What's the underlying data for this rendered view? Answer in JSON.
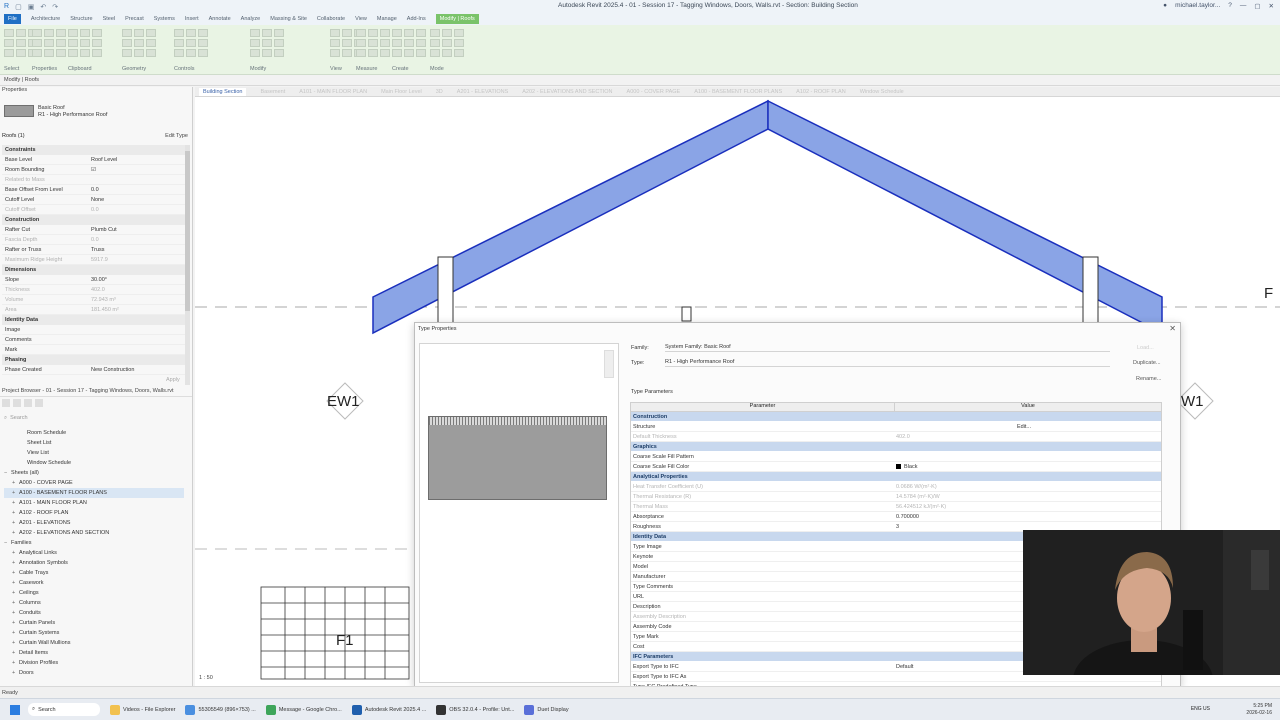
{
  "window": {
    "title": "Autodesk Revit 2025.4 - 01 - Session 17 - Tagging Windows, Doors, Walls.rvt - Section: Building Section",
    "user": "michael.taylor..."
  },
  "ribbon": {
    "tabs": [
      "File",
      "Architecture",
      "Structure",
      "Steel",
      "Precast",
      "Systems",
      "Insert",
      "Annotate",
      "Analyze",
      "Massing & Site",
      "Collaborate",
      "View",
      "Manage",
      "Add-Ins",
      "Modify | Roofs"
    ],
    "groups": [
      "Select",
      "Properties",
      "Clipboard",
      "Geometry",
      "Controls",
      "Modify",
      "View",
      "Measure",
      "Create",
      "Mode"
    ],
    "context_label": "Modify | Roofs"
  },
  "properties": {
    "header": "Properties",
    "type_family": "Basic Roof",
    "type_name": "R1 - High Performance Roof",
    "count": "Roofs (1)",
    "edit_type": "Edit Type",
    "sections": [
      {
        "name": "Constraints",
        "rows": [
          {
            "k": "Base Level",
            "v": "Roof Level",
            "dim": false
          },
          {
            "k": "Room Bounding",
            "v": "☑",
            "dim": false
          },
          {
            "k": "Related to Mass",
            "v": "",
            "dim": true
          },
          {
            "k": "Base Offset From Level",
            "v": "0.0",
            "dim": false
          },
          {
            "k": "Cutoff Level",
            "v": "None",
            "dim": false
          },
          {
            "k": "Cutoff Offset",
            "v": "0.0",
            "dim": true
          }
        ]
      },
      {
        "name": "Construction",
        "rows": [
          {
            "k": "Rafter Cut",
            "v": "Plumb Cut",
            "dim": false
          },
          {
            "k": "Fascia Depth",
            "v": "0.0",
            "dim": true
          },
          {
            "k": "Rafter or Truss",
            "v": "Truss",
            "dim": false
          },
          {
            "k": "Maximum Ridge Height",
            "v": "5917.9",
            "dim": true
          }
        ]
      },
      {
        "name": "Dimensions",
        "rows": [
          {
            "k": "Slope",
            "v": "30.00°",
            "dim": false
          },
          {
            "k": "Thickness",
            "v": "402.0",
            "dim": true
          },
          {
            "k": "Volume",
            "v": "72.943 m³",
            "dim": true
          },
          {
            "k": "Area",
            "v": "181.450 m²",
            "dim": true
          }
        ]
      },
      {
        "name": "Identity Data",
        "rows": [
          {
            "k": "Image",
            "v": "",
            "dim": false
          },
          {
            "k": "Comments",
            "v": "",
            "dim": false
          },
          {
            "k": "Mark",
            "v": "",
            "dim": false
          }
        ]
      },
      {
        "name": "Phasing",
        "rows": [
          {
            "k": "Phase Created",
            "v": "New Construction",
            "dim": false
          }
        ]
      }
    ],
    "apply": "Apply"
  },
  "browser": {
    "header": "Project Browser - 01 - Session 17 - Tagging Windows, Doors, Walls.rvt",
    "search_placeholder": "Search",
    "items": [
      {
        "label": "Room Schedule",
        "indent": 2,
        "pm": "",
        "sel": false
      },
      {
        "label": "Sheet List",
        "indent": 2,
        "pm": "",
        "sel": false
      },
      {
        "label": "View List",
        "indent": 2,
        "pm": "",
        "sel": false
      },
      {
        "label": "Window Schedule",
        "indent": 2,
        "pm": "",
        "sel": false
      },
      {
        "label": "Sheets (all)",
        "indent": 0,
        "pm": "−",
        "sel": false
      },
      {
        "label": "A000 - COVER PAGE",
        "indent": 1,
        "pm": "+",
        "sel": false
      },
      {
        "label": "A100 - BASEMENT FLOOR PLANS",
        "indent": 1,
        "pm": "+",
        "sel": true
      },
      {
        "label": "A101 - MAIN FLOOR PLAN",
        "indent": 1,
        "pm": "+",
        "sel": false
      },
      {
        "label": "A102 - ROOF PLAN",
        "indent": 1,
        "pm": "+",
        "sel": false
      },
      {
        "label": "A201 - ELEVATIONS",
        "indent": 1,
        "pm": "+",
        "sel": false
      },
      {
        "label": "A202 - ELEVATIONS AND SECTION",
        "indent": 1,
        "pm": "+",
        "sel": false
      },
      {
        "label": "Families",
        "indent": 0,
        "pm": "−",
        "sel": false
      },
      {
        "label": "Analytical Links",
        "indent": 1,
        "pm": "+",
        "sel": false
      },
      {
        "label": "Annotation Symbols",
        "indent": 1,
        "pm": "+",
        "sel": false
      },
      {
        "label": "Cable Trays",
        "indent": 1,
        "pm": "+",
        "sel": false
      },
      {
        "label": "Casework",
        "indent": 1,
        "pm": "+",
        "sel": false
      },
      {
        "label": "Ceilings",
        "indent": 1,
        "pm": "+",
        "sel": false
      },
      {
        "label": "Columns",
        "indent": 1,
        "pm": "+",
        "sel": false
      },
      {
        "label": "Conduits",
        "indent": 1,
        "pm": "+",
        "sel": false
      },
      {
        "label": "Curtain Panels",
        "indent": 1,
        "pm": "+",
        "sel": false
      },
      {
        "label": "Curtain Systems",
        "indent": 1,
        "pm": "+",
        "sel": false
      },
      {
        "label": "Curtain Wall Mullions",
        "indent": 1,
        "pm": "+",
        "sel": false
      },
      {
        "label": "Detail Items",
        "indent": 1,
        "pm": "+",
        "sel": false
      },
      {
        "label": "Division Profiles",
        "indent": 1,
        "pm": "+",
        "sel": false
      },
      {
        "label": "Doors",
        "indent": 1,
        "pm": "+",
        "sel": false
      }
    ]
  },
  "view_tabs": [
    {
      "label": "Building Section",
      "active": true
    },
    {
      "label": "Basement",
      "active": false
    },
    {
      "label": "A101 - MAIN FLOOR PLAN",
      "active": false
    },
    {
      "label": "Main Floor Level",
      "active": false
    },
    {
      "label": "3D",
      "active": false
    },
    {
      "label": "A201 - ELEVATIONS",
      "active": false
    },
    {
      "label": "A202 - ELEVATIONS AND SECTION",
      "active": false
    },
    {
      "label": "A000 - COVER PAGE",
      "active": false
    },
    {
      "label": "A100 - BASEMENT FLOOR PLANS",
      "active": false
    },
    {
      "label": "A102 - ROOF PLAN",
      "active": false
    },
    {
      "label": "Window Schedule",
      "active": false
    }
  ],
  "canvas": {
    "tags": {
      "ew1": "EW1",
      "w1": "W1",
      "f1": "F1",
      "f_edge": "F"
    },
    "view_scale": "1 : 50"
  },
  "dialog": {
    "title": "Type Properties",
    "family_label": "Family:",
    "family_value": "System Family: Basic Roof",
    "type_label": "Type:",
    "type_value": "R1 - High Performance Roof",
    "load": "Load...",
    "duplicate": "Duplicate...",
    "rename": "Rename...",
    "type_parameters": "Type Parameters",
    "col_parameter": "Parameter",
    "col_value": "Value",
    "sections": [
      {
        "name": "Construction",
        "rows": [
          {
            "k": "Structure",
            "v": "",
            "btn": "Edit...",
            "dim": false
          },
          {
            "k": "Default Thickness",
            "v": "402.0",
            "dim": true
          }
        ]
      },
      {
        "name": "Graphics",
        "rows": [
          {
            "k": "Coarse Scale Fill Pattern",
            "v": "",
            "dim": false
          },
          {
            "k": "Coarse Scale Fill Color",
            "v": "Black",
            "swatch": true,
            "dim": false
          }
        ]
      },
      {
        "name": "Analytical Properties",
        "rows": [
          {
            "k": "Heat Transfer Coefficient (U)",
            "v": "0.0686 W/(m²·K)",
            "dim": true
          },
          {
            "k": "Thermal Resistance (R)",
            "v": "14.5784 (m²·K)/W",
            "dim": true
          },
          {
            "k": "Thermal Mass",
            "v": "56.424512 kJ/(m²·K)",
            "dim": true
          },
          {
            "k": "Absorptance",
            "v": "0.700000",
            "dim": false
          },
          {
            "k": "Roughness",
            "v": "3",
            "dim": false
          }
        ]
      },
      {
        "name": "Identity Data",
        "rows": [
          {
            "k": "Type Image",
            "v": "",
            "dim": false
          },
          {
            "k": "Keynote",
            "v": "",
            "dim": false
          },
          {
            "k": "Model",
            "v": "",
            "dim": false
          },
          {
            "k": "Manufacturer",
            "v": "",
            "dim": false
          },
          {
            "k": "Type Comments",
            "v": "",
            "dim": false
          },
          {
            "k": "URL",
            "v": "",
            "dim": false
          },
          {
            "k": "Description",
            "v": "",
            "dim": false
          },
          {
            "k": "Assembly Description",
            "v": "",
            "dim": true
          },
          {
            "k": "Assembly Code",
            "v": "",
            "dim": false
          },
          {
            "k": "Type Mark",
            "v": "",
            "dim": false
          },
          {
            "k": "Cost",
            "v": "",
            "dim": false
          }
        ]
      },
      {
        "name": "IFC Parameters",
        "rows": [
          {
            "k": "Export Type to IFC",
            "v": "Default",
            "dim": false
          },
          {
            "k": "Export Type to IFC As",
            "v": "",
            "dim": false
          },
          {
            "k": "Type IFC Predefined Type",
            "v": "",
            "dim": false
          }
        ]
      }
    ]
  },
  "status": {
    "text": "Ready"
  },
  "taskbar": {
    "search": "Search",
    "apps": [
      {
        "label": "Videos - File Explorer",
        "color": "#f2c14e"
      },
      {
        "label": "55305549 (896×753) ...",
        "color": "#4a8fe0"
      },
      {
        "label": "Message - Google Chro...",
        "color": "#3ea55a"
      },
      {
        "label": "Autodesk Revit 2025.4 ...",
        "color": "#1f5fae"
      },
      {
        "label": "OBS 32.0.4 - Profile: Unt...",
        "color": "#333333"
      },
      {
        "label": "Duet Display",
        "color": "#5a6fd8"
      }
    ],
    "lang": "ENG US",
    "time": "5:25 PM",
    "date": "2026-02-16"
  },
  "colors": {
    "roof_fill": "#8aa4e6",
    "roof_stroke": "#1a2fbd",
    "accent": "#1f6fc4",
    "ctx_tab": "#7ac36a"
  }
}
